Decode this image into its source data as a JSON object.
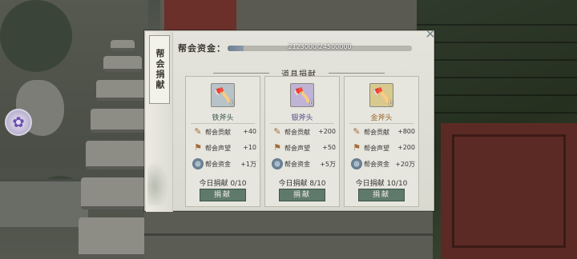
{
  "panel": {
    "tab_label": "帮会捐献",
    "funds_label": "帮会资金：",
    "funds_value": "2123000/24500000",
    "funds_fraction": 0.0867,
    "section_title": "道具捐献"
  },
  "colors": {
    "button_green": "#5f7a6a",
    "iron_name": "#3d5a4a",
    "silver_name": "#5a4a86",
    "gold_name": "#9a6a2a"
  },
  "cards": [
    {
      "name": "铁斧头",
      "icon": "axe-head-icon",
      "count": "0",
      "rewards": [
        {
          "label": "帮会贡献",
          "value": "+40"
        },
        {
          "label": "帮会声望",
          "value": "+10"
        },
        {
          "label": "帮会资金",
          "value": "+1万"
        }
      ],
      "today": "今日捐献 0/10",
      "button": "捐献"
    },
    {
      "name": "银斧头",
      "icon": "axe-head-icon",
      "count": "0",
      "rewards": [
        {
          "label": "帮会贡献",
          "value": "+200"
        },
        {
          "label": "帮会声望",
          "value": "+50"
        },
        {
          "label": "帮会资金",
          "value": "+5万"
        }
      ],
      "today": "今日捐献 8/10",
      "button": "捐献"
    },
    {
      "name": "金斧头",
      "icon": "axe-head-icon",
      "count": "0",
      "rewards": [
        {
          "label": "帮会贡献",
          "value": "+800"
        },
        {
          "label": "帮会声望",
          "value": "+200"
        },
        {
          "label": "帮会资金",
          "value": "+20万"
        }
      ],
      "today": "今日捐献 10/10",
      "button": "捐献"
    }
  ]
}
